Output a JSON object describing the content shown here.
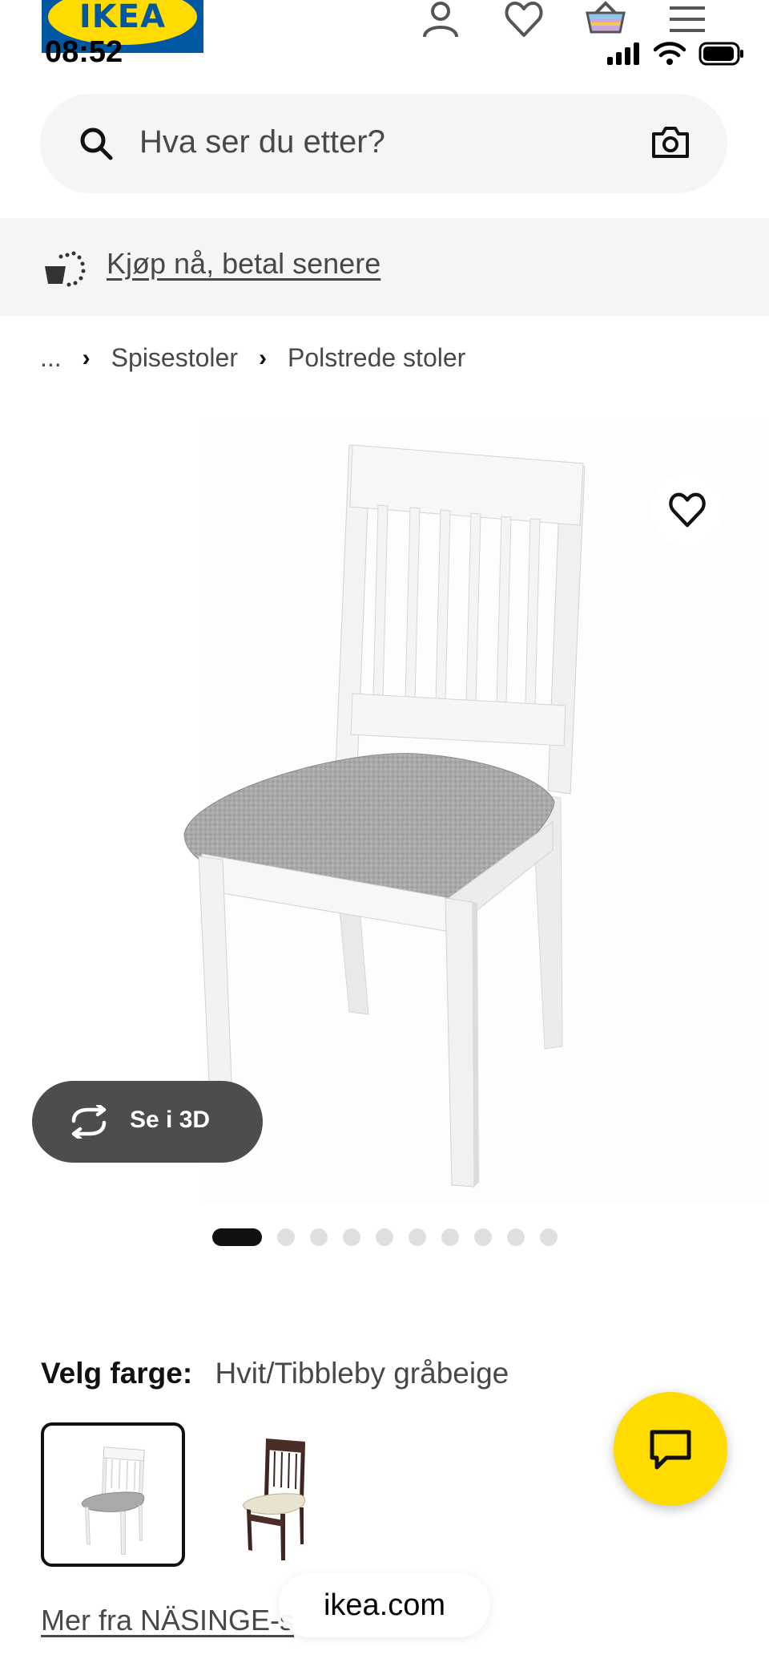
{
  "brand": {
    "logo_text": "IKEA"
  },
  "status_bar": {
    "time": "08:52"
  },
  "header": {
    "icons": [
      "user-icon",
      "heart-icon",
      "cart-icon",
      "menu-icon"
    ]
  },
  "search": {
    "placeholder": "Hva ser du etter?"
  },
  "promo": {
    "label": "Kjøp nå, betal senere"
  },
  "breadcrumb": {
    "ellipsis": "...",
    "items": [
      "Spisestoler",
      "Polstrede stoler"
    ]
  },
  "gallery": {
    "view_3d_label": "Se i 3D",
    "image_count": 10,
    "active_index": 0
  },
  "color": {
    "label": "Velg farge:",
    "value": "Hvit/Tibbleby gråbeige",
    "options": [
      {
        "name": "white-chair",
        "selected": true
      },
      {
        "name": "brown-chair",
        "selected": false
      }
    ]
  },
  "more_link": "Mer fra NÄSINGE-s",
  "browser": {
    "url": "ikea.com"
  },
  "colors": {
    "ikea_blue": "#0058a3",
    "ikea_yellow": "#ffdb00",
    "text_dark": "#111111",
    "text_muted": "#484848",
    "surface_grey": "#f5f5f5"
  }
}
